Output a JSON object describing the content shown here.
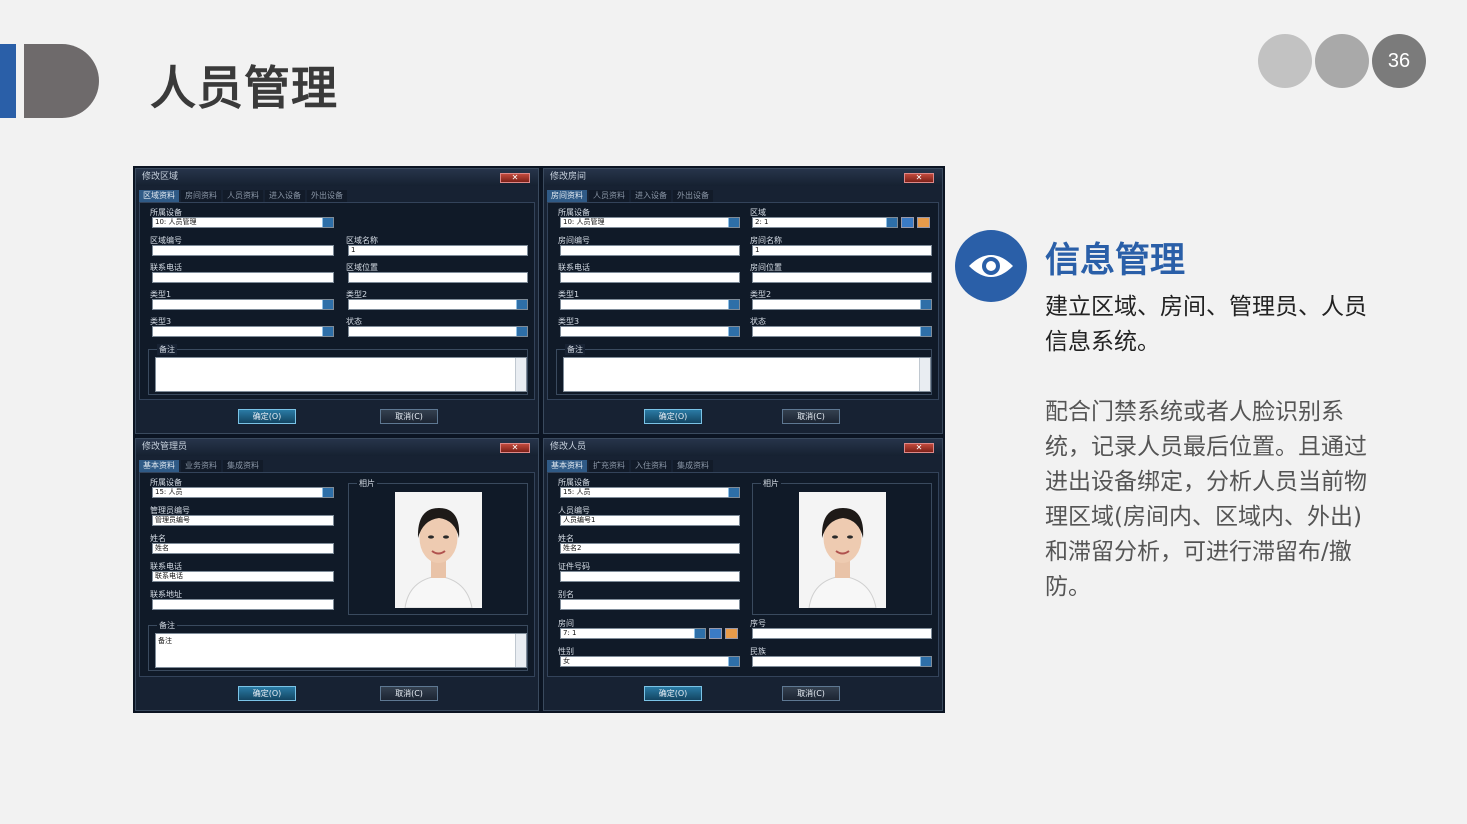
{
  "slide": {
    "title": "人员管理",
    "page_number": "36"
  },
  "info": {
    "heading": "信息管理",
    "para1": "建立区域、房间、管理员、人员信息系统。",
    "para2": "配合门禁系统或者人脸识别系统，记录人员最后位置。且通过进出设备绑定，分析人员当前物理区域(房间内、区域内、外出)和滞留分析，可进行滞留布/撤防。",
    "icon": "eye-icon"
  },
  "dlg_area": {
    "title": "修改区域",
    "tabs": [
      "区域资料",
      "房间资料",
      "人员资料",
      "进入设备",
      "外出设备"
    ],
    "device_label": "所属设备",
    "device_value": "10: 人员管理",
    "code_label": "区域编号",
    "name_label": "区域名称",
    "name_value": "1",
    "phone_label": "联系电话",
    "loc_label": "区域位置",
    "type1_label": "类型1",
    "type2_label": "类型2",
    "type3_label": "类型3",
    "status_label": "状态",
    "note_label": "备注",
    "ok": "确定(O)",
    "cancel": "取消(C)"
  },
  "dlg_room": {
    "title": "修改房间",
    "tabs": [
      "房间资料",
      "人员资料",
      "进入设备",
      "外出设备"
    ],
    "device_label": "所属设备",
    "device_value": "10: 人员管理",
    "area_label": "区域",
    "area_value": "2: 1",
    "code_label": "房间编号",
    "name_label": "房间名称",
    "name_value": "1",
    "phone_label": "联系电话",
    "loc_label": "房间位置",
    "type1_label": "类型1",
    "type2_label": "类型2",
    "type3_label": "类型3",
    "status_label": "状态",
    "note_label": "备注",
    "ok": "确定(O)",
    "cancel": "取消(C)"
  },
  "dlg_admin": {
    "title": "修改管理员",
    "tabs": [
      "基本资料",
      "业务资料",
      "集成资料"
    ],
    "device_label": "所属设备",
    "device_value": "15: 人员",
    "code_label": "管理员编号",
    "code_value": "管理员编号",
    "name_label": "姓名",
    "name_value": "姓名",
    "phone_label": "联系电话",
    "phone_value": "联系电话",
    "addr_label": "联系地址",
    "photo_label": "相片",
    "note_label": "备注",
    "note_value": "备注",
    "ok": "确定(O)",
    "cancel": "取消(C)"
  },
  "dlg_person": {
    "title": "修改人员",
    "tabs": [
      "基本资料",
      "扩充资料",
      "入住资料",
      "集成资料"
    ],
    "device_label": "所属设备",
    "device_value": "15: 人员",
    "code_label": "人员编号",
    "code_value": "人员编号1",
    "name_label": "姓名",
    "name_value": "姓名2",
    "id_label": "证件号码",
    "alias_label": "别名",
    "photo_label": "相片",
    "room_label": "房间",
    "room_value": "7: 1",
    "seq_label": "序号",
    "gender_label": "性别",
    "gender_value": "女",
    "ethnic_label": "民族",
    "ok": "确定(O)",
    "cancel": "取消(C)"
  }
}
